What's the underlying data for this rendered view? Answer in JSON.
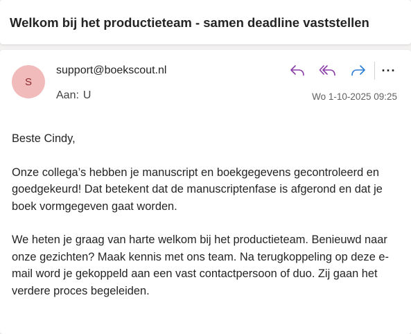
{
  "subject": "Welkom bij het productieteam - samen deadline vaststellen",
  "message": {
    "avatar_initial": "S",
    "sender": "support@boekscout.nl",
    "to_label": "Aan:",
    "to_value": "U",
    "timestamp": "Wo 1-10-2025 09:25",
    "actions": {
      "reply_icon": "reply-icon",
      "reply_all_icon": "reply-all-icon",
      "forward_icon": "forward-icon",
      "more_label": "···"
    },
    "colors": {
      "reply": "#8a3ba8",
      "forward": "#2b7cd3",
      "avatar_bg": "#f1bbbc"
    },
    "body": {
      "greeting": "Beste Cindy,",
      "paragraph1": "Onze collega’s hebben je manuscript en boekgegevens gecontroleerd en goedgekeurd! Dat betekent dat de manuscriptenfase is afgerond en dat je boek vormgegeven gaat worden.",
      "paragraph2": "We heten je graag van harte welkom bij het productieteam. Benieuwd naar onze gezichten? Maak kennis met ons team. Na terugkoppeling op deze e-mail word je gekoppeld aan een vast contactpersoon of duo. Zij gaan het verdere proces begeleiden."
    }
  }
}
